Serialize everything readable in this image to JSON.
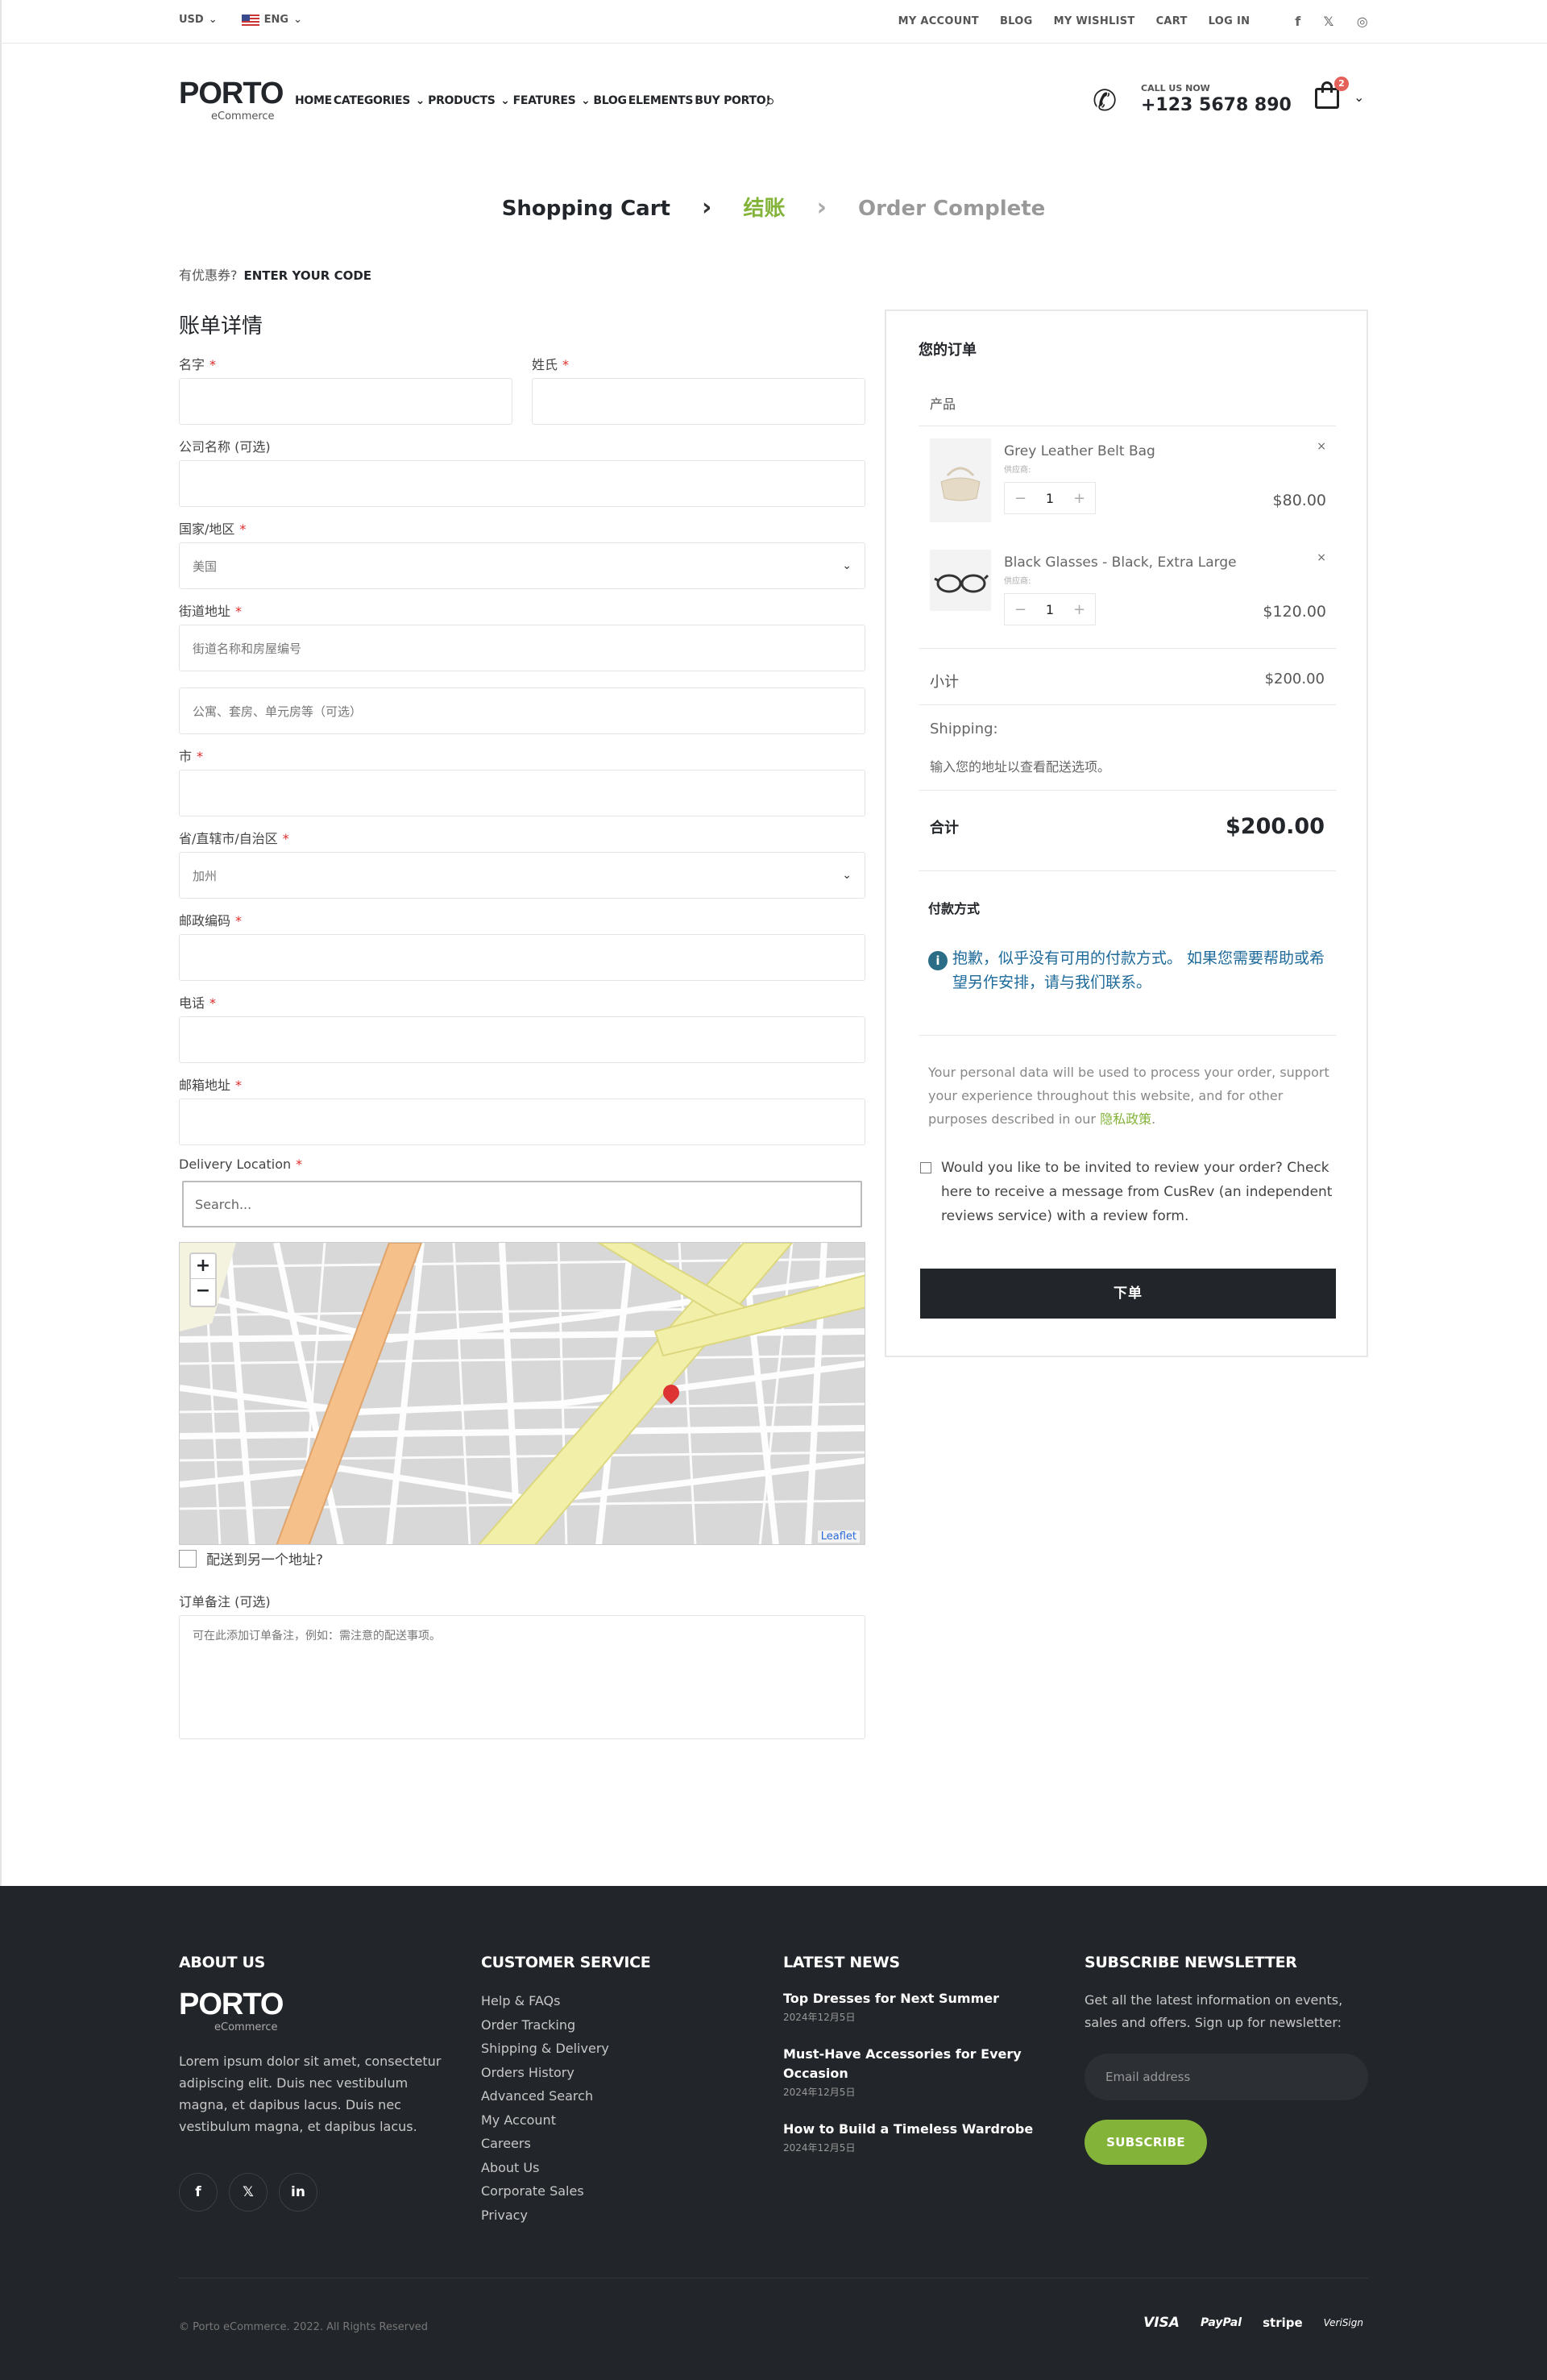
{
  "topbar": {
    "currency": "USD",
    "language": "ENG",
    "links": [
      "MY ACCOUNT",
      "BLOG",
      "MY WISHLIST",
      "CART",
      "LOG IN"
    ],
    "social_icons": [
      "facebook-icon",
      "x-icon",
      "instagram-icon"
    ]
  },
  "header": {
    "logo": "PORTO",
    "logo_sub": "eCommerce",
    "nav": [
      "HOME",
      "CATEGORIES",
      "PRODUCTS",
      "FEATURES",
      "BLOG",
      "ELEMENTS",
      "BUY PORTO!"
    ],
    "call_label": "CALL US NOW",
    "phone": "+123 5678 890",
    "cart_count": "2"
  },
  "steps": {
    "cart": "Shopping Cart",
    "checkout": "结账",
    "complete": "Order Complete"
  },
  "coupon": {
    "prompt": "有优惠券?",
    "link": "ENTER YOUR CODE"
  },
  "billing": {
    "title": "账单详情",
    "first_name": "名字",
    "last_name": "姓氏",
    "company": "公司名称 (可选)",
    "country_label": "国家/地区",
    "country_value": "美国",
    "street_label": "街道地址",
    "street_placeholder": "街道名称和房屋编号",
    "street2_placeholder": "公寓、套房、单元房等（可选）",
    "city_label": "市",
    "state_label": "省/直辖市/自治区",
    "state_value": "加州",
    "zip_label": "邮政编码",
    "phone_label": "电话",
    "email_label": "邮箱地址",
    "delivery_label": "Delivery Location",
    "delivery_search": "Search...",
    "map_attribution": "Leaflet",
    "ship_different": "配送到另一个地址?",
    "notes_label": "订单备注 (可选)",
    "notes_placeholder": "可在此添加订单备注，例如：需注意的配送事项。"
  },
  "order": {
    "title": "您的订单",
    "product_header": "产品",
    "items": [
      {
        "name": "Grey Leather Belt Bag",
        "vendor": "供应商:",
        "qty": "1",
        "price": "$80.00"
      },
      {
        "name": "Black Glasses - Black, Extra Large",
        "vendor": "供应商:",
        "qty": "1",
        "price": "$120.00"
      }
    ],
    "subtotal_label": "小计",
    "subtotal": "$200.00",
    "shipping_label": "Shipping:",
    "shipping_note": "输入您的地址以查看配送选项。",
    "total_label": "合计",
    "total": "$200.00",
    "payment_label": "付款方式",
    "payment_notice": "抱歉，似乎没有可用的付款方式。 如果您需要帮助或希望另作安排，请与我们联系。",
    "privacy_text": "Your personal data will be used to process your order, support your experience throughout this website, and for other purposes described in our",
    "privacy_link": "隐私政策",
    "review_text": "Would you like to be invited to review your order? Check here to receive a message from CusRev (an independent reviews service) with a review form.",
    "place_order": "下单"
  },
  "footer": {
    "about_title": "ABOUT US",
    "about_logo": "PORTO",
    "about_logo_sub": "eCommerce",
    "about_text": "Lorem ipsum dolor sit amet, consectetur adipiscing elit. Duis nec vestibulum magna, et dapibus lacus. Duis nec vestibulum magna, et dapibus lacus.",
    "cs_title": "CUSTOMER SERVICE",
    "cs_links": [
      "Help & FAQs",
      "Order Tracking",
      "Shipping & Delivery",
      "Orders History",
      "Advanced Search",
      "My Account",
      "Careers",
      "About Us",
      "Corporate Sales",
      "Privacy"
    ],
    "news_title": "LATEST NEWS",
    "news": [
      {
        "title": "Top Dresses for Next Summer",
        "date": "2024年12月5日"
      },
      {
        "title": "Must-Have Accessories for Every Occasion",
        "date": "2024年12月5日"
      },
      {
        "title": "How to Build a Timeless Wardrobe",
        "date": "2024年12月5日"
      }
    ],
    "newsletter_title": "SUBSCRIBE NEWSLETTER",
    "newsletter_text": "Get all the latest information on events, sales and offers. Sign up for newsletter:",
    "email_placeholder": "Email address",
    "subscribe": "SUBSCRIBE",
    "copyright": "© Porto eCommerce. 2022. All Rights Reserved",
    "payments": [
      "VISA",
      "PayPal",
      "stripe",
      "VeriSign"
    ]
  }
}
